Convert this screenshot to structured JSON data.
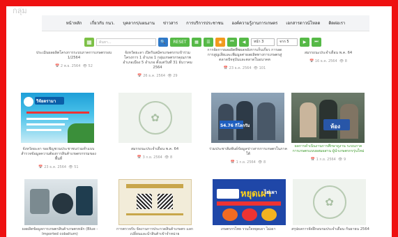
{
  "header": {
    "partial_text": "กลุ่ม"
  },
  "nav": {
    "items": [
      "หน้าหลัก",
      "เกี่ยวกับ กนว.",
      "บุคลากร/แผนงาน",
      "ข่าวสาร",
      "การบริการประชาชน",
      "องค์ความรู้งานการเกษตร",
      "เอกสารดาวน์โหลด",
      "ติดต่อเรา"
    ]
  },
  "toolbar": {
    "search_placeholder": "ค้นหา...",
    "search_icon_glyph": "🔍",
    "reset_label": "RESET",
    "page_select": "หน้า 3",
    "page_total": "จาก 5"
  },
  "cards_row1": [
    {
      "title": "ประเมินผลผลิตโครงการระบบภาคการเกษตรรอบ 1/2564",
      "date": "2 พ.ย. 2564",
      "views": "52"
    },
    {
      "title": "จังหวัดยะลา เปิดรับสมัครเกษตรกรเข้าร่วมโครงการ 1 อำเภอ 1 กลุ่มเกษตรกรคุณภาพ อำเภอเมือง 5 อำเภอ ตั้งแต่วันที่ 31 ธันวาคม 2564",
      "date": "26 ธ.ค. 2564",
      "views": "29"
    },
    {
      "title": "การจัดการผลผลิตพืชผลหลังการเก็บเกี่ยว การลดการสูญเสียและเพิ่มมูลค่าผลผลิตทางการเกษตรสู่ตลาดปัจจุบันและตลาดในอนาคต",
      "date": "23 ธ.ค. 2564",
      "views": "101"
    },
    {
      "title": "สมรรถนะประจำเดือน พ.ค. 64",
      "date": "16 ธ.ค. 2564",
      "views": "8"
    }
  ],
  "cards_row2": [
    {
      "title": "จังหวัดยะลา ขอเชิญชวนประชาชนร่วมทำแบบสำรวจข้อมูลความต้องการสินค้าเกษตรกรรมของพื้นที่",
      "date": "23 ธ.ค. 2564",
      "views": "51",
      "badge": "วิจัยดรามา"
    },
    {
      "title": "สมรรถนะประจำเดือน พ.ค. 64",
      "date": "3 ก.ย. 2564",
      "views": "8"
    },
    {
      "title": "ร่วมประชาสัมพันธ์ข้อมูลข่าวสารการเกษตรในภาคใต้",
      "date": "1 ก.ย. 2564",
      "views": "8",
      "badge": "54.76 กิโลกรัม"
    },
    {
      "title": "ผลการดำเนินงานการศึกษาดูงาน ระบบภาคการเกษตรแบบผสมผสาน ผู้นำเกษตรกรรุ่นใหม่",
      "date": "1 ก.ย. 2564",
      "views": "9",
      "badge": "ห้อง"
    }
  ],
  "cards_row3": [
    {
      "title": "ผลผลิตข้อมูลการเกษตรสินค้าเกษตรหลัก (Blue - Imported cobaltum)"
    },
    {
      "title": "การตรวจรับ จัดงานการประกวดสินค้าเกษตร แลกเปลี่ยนและนำสินค้าเข้าจำหน่าย"
    },
    {
      "title": "เกษตรกรไทย รวมใจหยุดเผา ไม่เผา",
      "poster_title": "หยุดเผา",
      "poster_sub": "ไม่เผา"
    },
    {
      "title": "สรุปผลการจัดฝึกอบรมประจำเดือน กันยายน 2564"
    }
  ],
  "colors": {
    "frame": "#ee1111",
    "green": "#56b947",
    "blue": "#2f79c8",
    "orange": "#f29a1d",
    "link_green": "#3f9b2e"
  }
}
